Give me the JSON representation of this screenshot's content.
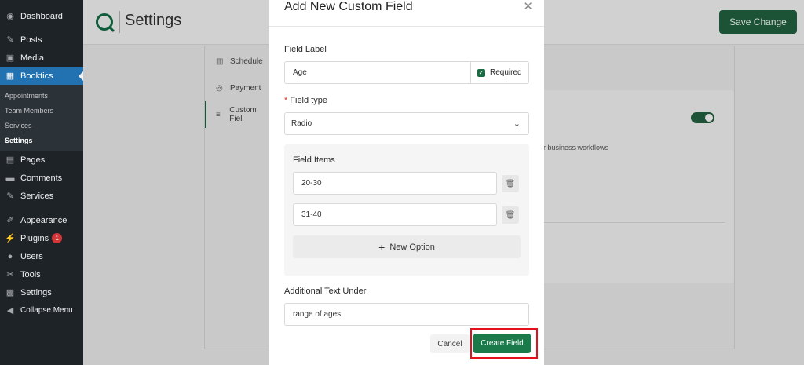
{
  "wp_menu": {
    "items_top": [
      {
        "label": "Dashboard",
        "icon": "dashboard-icon",
        "glyph": "◉"
      },
      {
        "label": "Posts",
        "icon": "pin-icon",
        "glyph": "✎"
      },
      {
        "label": "Media",
        "icon": "media-icon",
        "glyph": "▣"
      },
      {
        "label": "Booktics",
        "icon": "calendar-icon",
        "glyph": "▦"
      }
    ],
    "submenu": [
      "Appointments",
      "Team Members",
      "Services",
      "Settings"
    ],
    "items_bottom": [
      {
        "label": "Pages",
        "icon": "pages-icon",
        "glyph": "▤"
      },
      {
        "label": "Comments",
        "icon": "comment-icon",
        "glyph": "▬"
      },
      {
        "label": "Services",
        "icon": "pin-icon",
        "glyph": "✎"
      },
      {
        "label": "Appearance",
        "icon": "brush-icon",
        "glyph": "✐"
      },
      {
        "label": "Plugins",
        "icon": "plugin-icon",
        "glyph": "⚡",
        "badge": "1"
      },
      {
        "label": "Users",
        "icon": "user-icon",
        "glyph": "●"
      },
      {
        "label": "Tools",
        "icon": "wrench-icon",
        "glyph": "✂"
      },
      {
        "label": "Settings",
        "icon": "settings-icon",
        "glyph": "▩"
      },
      {
        "label": "Collapse Menu",
        "icon": "collapse-icon",
        "glyph": "◀"
      }
    ]
  },
  "header": {
    "title": "Settings",
    "save_label": "Save Change"
  },
  "settings_nav": [
    {
      "label": "Schedule",
      "icon": "schedule-icon",
      "glyph": "▥"
    },
    {
      "label": "Payment",
      "icon": "payment-icon",
      "glyph": "◎"
    },
    {
      "label": "Custom Fiel",
      "icon": "custom-fields-icon",
      "glyph": "≡"
    }
  ],
  "background_card": {
    "text": "ur business workflows"
  },
  "modal": {
    "title": "Add New Custom Field",
    "close_glyph": "✕",
    "field_label": {
      "label": "Field Label",
      "value": "Age",
      "required_label": "Required",
      "required_checked": true
    },
    "field_type": {
      "label": "Field type",
      "value": "Radio"
    },
    "field_items": {
      "label": "Field Items",
      "items": [
        "20-30",
        "31-40"
      ],
      "add_label": "New Option"
    },
    "additional_text": {
      "label": "Additional Text Under",
      "value": "range of ages"
    },
    "cancel_label": "Cancel",
    "create_label": "Create Field"
  },
  "colors": {
    "primary": "#1a7a4a",
    "wp_sidebar": "#1d2327",
    "wp_active": "#2271b1",
    "highlight": "#e4101c"
  }
}
